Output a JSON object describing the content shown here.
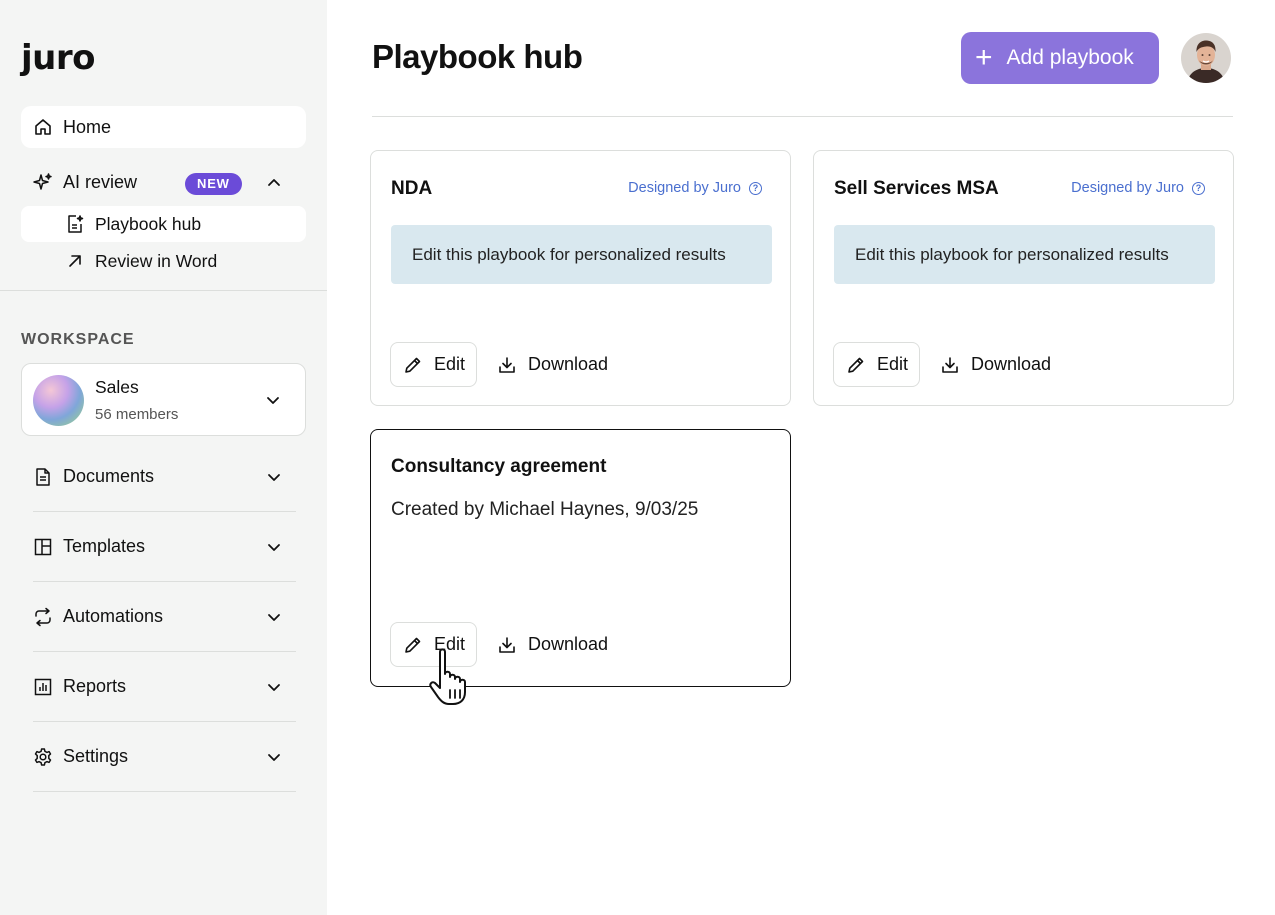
{
  "sidebar": {
    "logo": "juro",
    "home_label": "Home",
    "ai_review": {
      "label": "AI review",
      "badge": "NEW"
    },
    "sub_items": [
      {
        "label": "Playbook hub",
        "icon": "playbook-icon",
        "active": true
      },
      {
        "label": "Review in Word",
        "icon": "arrow-up-right-icon",
        "active": false
      }
    ],
    "workspace_heading": "WORKSPACE",
    "workspace": {
      "name": "Sales",
      "members": "56 members"
    },
    "menu": [
      {
        "label": "Documents",
        "icon": "document-icon"
      },
      {
        "label": "Templates",
        "icon": "templates-icon"
      },
      {
        "label": "Automations",
        "icon": "automations-icon"
      },
      {
        "label": "Reports",
        "icon": "reports-icon"
      },
      {
        "label": "Settings",
        "icon": "gear-icon"
      }
    ]
  },
  "header": {
    "title": "Playbook hub",
    "add_button": "Add playbook"
  },
  "cards": [
    {
      "title": "NDA",
      "designed_by": "Designed by Juro",
      "notice": "Edit this playbook for personalized results",
      "edit_label": "Edit",
      "download_label": "Download"
    },
    {
      "title": "Sell Services MSA",
      "designed_by": "Designed by Juro",
      "notice": "Edit this playbook for personalized results",
      "edit_label": "Edit",
      "download_label": "Download"
    },
    {
      "title": "Consultancy agreement",
      "created": "Created by Michael Haynes, 9/03/25",
      "edit_label": "Edit",
      "download_label": "Download"
    }
  ],
  "colors": {
    "accent": "#8b74dc",
    "badge": "#6b4bd8",
    "link": "#4a6fcf",
    "notice_bg": "#d9e8ef",
    "sidebar_bg": "#f4f5f4"
  }
}
